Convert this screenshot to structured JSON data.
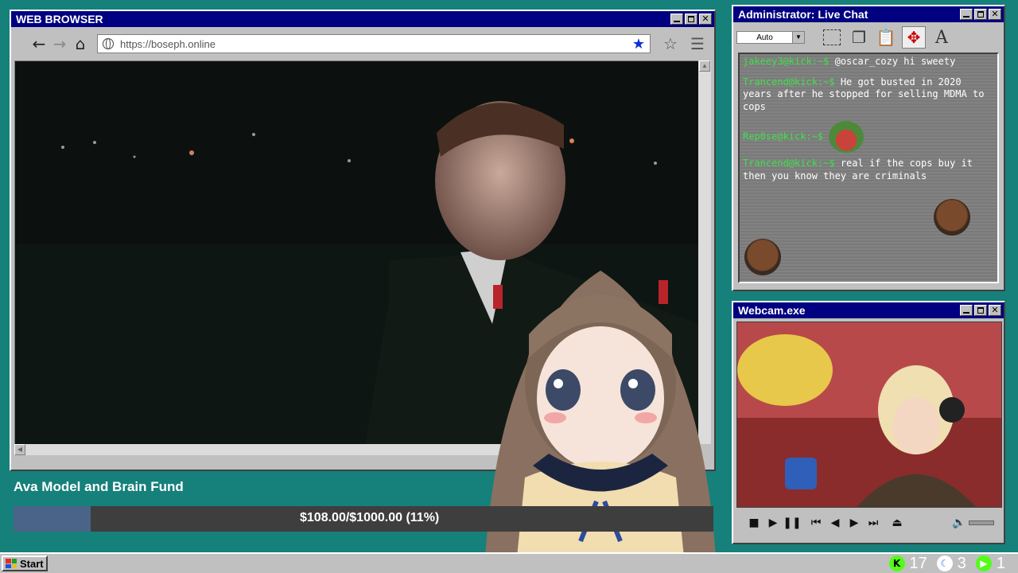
{
  "browser": {
    "title": "WEB BROWSER",
    "url": "https://boseph.online"
  },
  "chat": {
    "title": "Administrator: Live Chat",
    "font_size_option": "Auto",
    "messages": [
      {
        "user": "jakeey3@kick:~$",
        "text": "@oscar_cozy hi sweety"
      },
      {
        "user": "Trancend@kick:~$",
        "text": "He got busted in 2020 years after he stopped for selling MDMA to cops"
      },
      {
        "user": "Rep0se@kick:~$",
        "text": ""
      },
      {
        "user": "Trancend@kick:~$",
        "text": "real if the cops buy it then you know they are criminals"
      }
    ]
  },
  "webcam": {
    "title": "Webcam.exe"
  },
  "fund": {
    "title": "Ava Model and Brain Fund",
    "progress_text": "$108.00/$1000.00 (11%)",
    "raised": 108.0,
    "goal": 1000.0,
    "fraction": 0.11
  },
  "taskbar": {
    "start_label": "Start",
    "tray": [
      {
        "icon": "kick-icon",
        "value": "17",
        "color": "#53fc18"
      },
      {
        "icon": "moon-icon",
        "value": "3",
        "color": "#2f7de1"
      },
      {
        "icon": "play-icon",
        "value": "1",
        "color": "#53fc18"
      }
    ]
  },
  "colors": {
    "desktop": "#16807b",
    "titlebar": "#000080",
    "chat_user": "#3fe04a",
    "fund_fill": "#4a6388"
  }
}
